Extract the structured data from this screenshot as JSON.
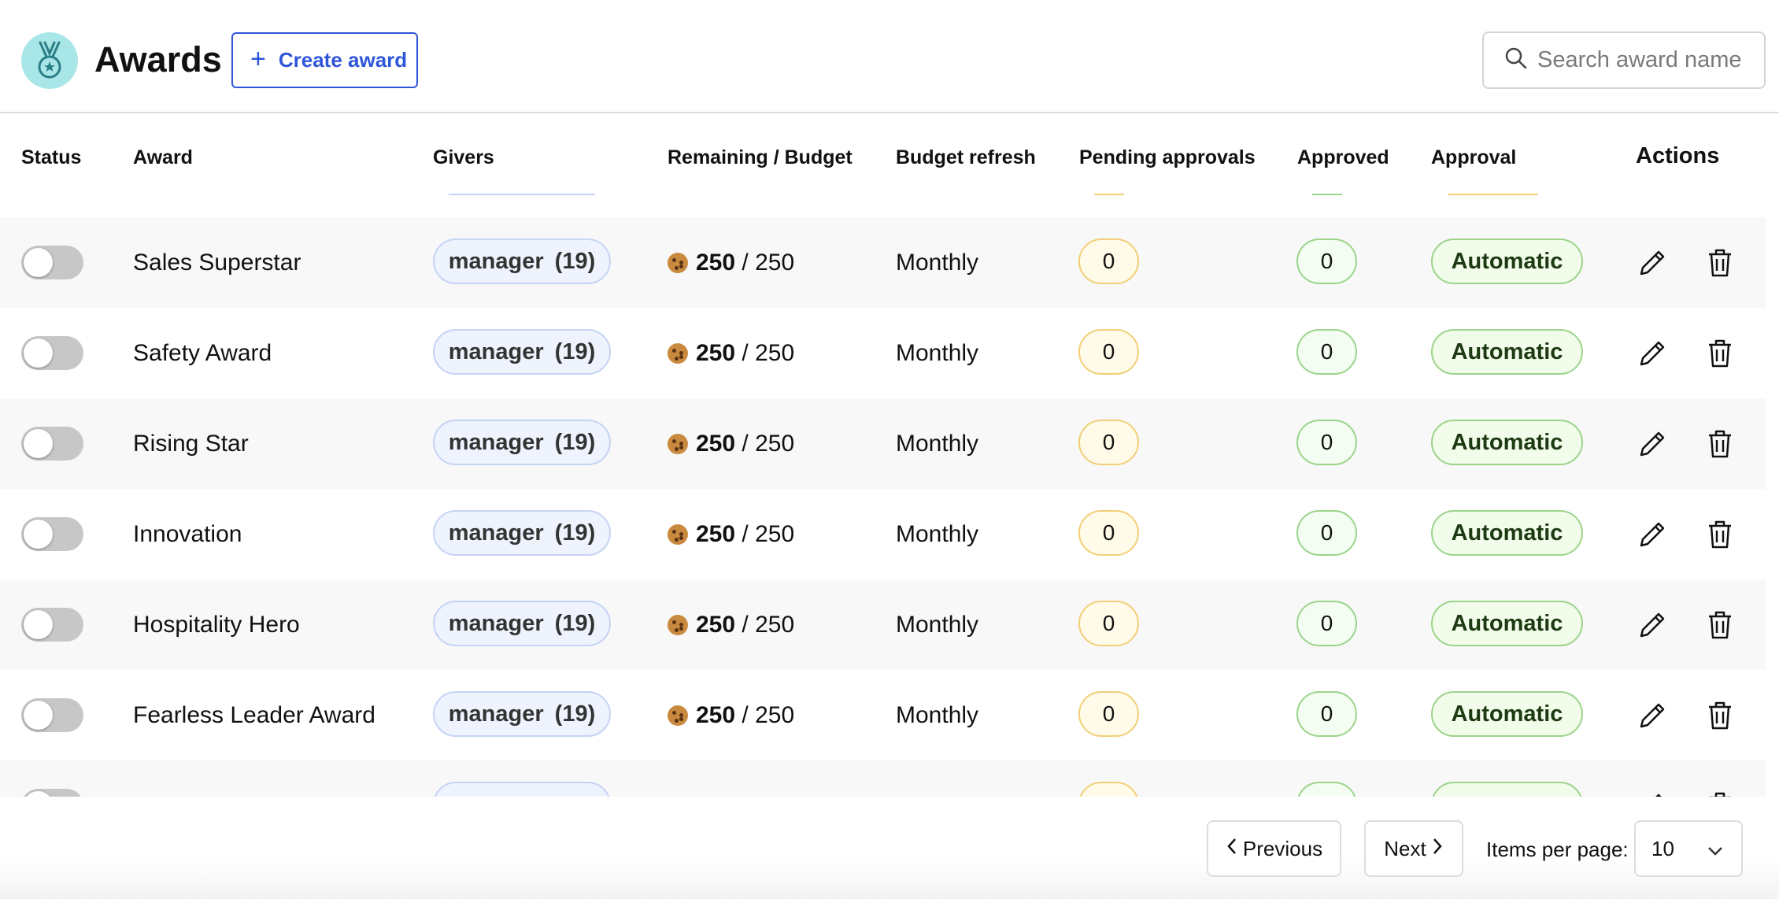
{
  "header": {
    "title": "Awards",
    "create_label": "Create award",
    "search_placeholder": "Search award name"
  },
  "columns": {
    "status": "Status",
    "award": "Award",
    "givers": "Givers",
    "budget": "Remaining / Budget",
    "refresh": "Budget refresh",
    "pending": "Pending approvals",
    "approved": "Approved",
    "approval": "Approval",
    "actions": "Actions"
  },
  "rows": [
    {
      "name": "Sales Superstar",
      "givers": "manager (19)",
      "remaining": "250",
      "budget": "/ 250",
      "refresh": "Monthly",
      "pending": "0",
      "approved": "0",
      "approval": "Automatic",
      "enabled": false
    },
    {
      "name": "Safety Award",
      "givers": "manager (19)",
      "remaining": "250",
      "budget": "/ 250",
      "refresh": "Monthly",
      "pending": "0",
      "approved": "0",
      "approval": "Automatic",
      "enabled": false
    },
    {
      "name": "Rising Star",
      "givers": "manager (19)",
      "remaining": "250",
      "budget": "/ 250",
      "refresh": "Monthly",
      "pending": "0",
      "approved": "0",
      "approval": "Automatic",
      "enabled": false
    },
    {
      "name": "Innovation",
      "givers": "manager (19)",
      "remaining": "250",
      "budget": "/ 250",
      "refresh": "Monthly",
      "pending": "0",
      "approved": "0",
      "approval": "Automatic",
      "enabled": false
    },
    {
      "name": "Hospitality Hero",
      "givers": "manager (19)",
      "remaining": "250",
      "budget": "/ 250",
      "refresh": "Monthly",
      "pending": "0",
      "approved": "0",
      "approval": "Automatic",
      "enabled": false
    },
    {
      "name": "Fearless Leader Award",
      "givers": "manager (19)",
      "remaining": "250",
      "budget": "/ 250",
      "refresh": "Monthly",
      "pending": "0",
      "approved": "0",
      "approval": "Automatic",
      "enabled": false
    },
    {
      "name": "",
      "givers": "",
      "remaining": "",
      "budget": "",
      "refresh": "",
      "pending": "",
      "approved": "",
      "approval": "",
      "enabled": false
    }
  ],
  "pagination": {
    "previous_label": "Previous",
    "next_label": "Next",
    "items_per_page_label": "Items per page:",
    "items_per_page_value": "10"
  },
  "colors": {
    "accent": "#2f56d9",
    "logo_bg": "#a9e6e8",
    "pending_border": "#f2cf77",
    "approved_border": "#9bd48a",
    "giver_border": "#c5d3f4"
  }
}
